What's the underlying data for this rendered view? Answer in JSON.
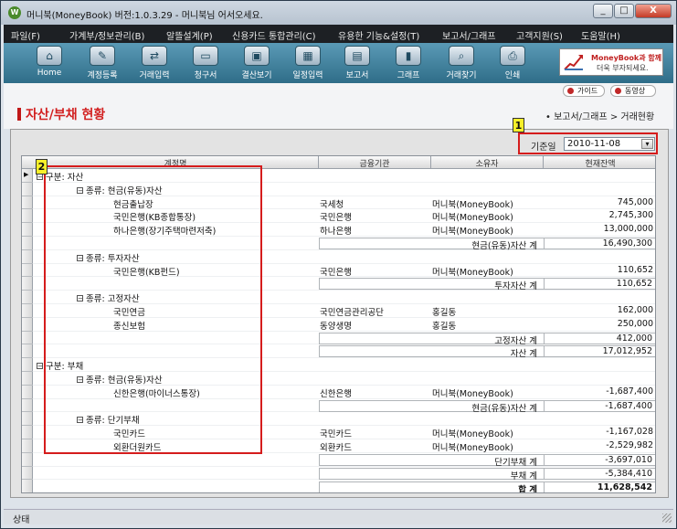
{
  "window": {
    "title": "머니북(MoneyBook) 버전:1.0.3.29 - 머니북님 어서오세요.",
    "app_icon_glyph": "W",
    "buttons": {
      "minimize": "_",
      "maximize": "□",
      "close": "X"
    }
  },
  "menu": [
    "파일(F)",
    "가계부/정보관리(B)",
    "알뜰설계(P)",
    "신용카드 통합관리(C)",
    "유용한 기능&설정(T)",
    "보고서/그래프",
    "고객지원(S)",
    "도움말(H)"
  ],
  "toolbar": [
    {
      "label": "Home",
      "icon": "home-icon",
      "glyph": "⌂"
    },
    {
      "label": "계정등록",
      "icon": "account-register-icon",
      "glyph": "✎"
    },
    {
      "label": "거래입력",
      "icon": "transaction-input-icon",
      "glyph": "⇄"
    },
    {
      "label": "청구서",
      "icon": "card-bill-icon",
      "glyph": "▭"
    },
    {
      "label": "결산보기",
      "icon": "monitor-icon",
      "glyph": "▣"
    },
    {
      "label": "일정입력",
      "icon": "calendar-icon",
      "glyph": "▦"
    },
    {
      "label": "보고서",
      "icon": "report-icon",
      "glyph": "▤"
    },
    {
      "label": "그래프",
      "icon": "bar-graph-icon",
      "glyph": "▮"
    },
    {
      "label": "거래찾기",
      "icon": "magnifier-icon",
      "glyph": "⌕"
    },
    {
      "label": "인쇄",
      "icon": "printer-icon",
      "glyph": "⎙"
    }
  ],
  "banner": {
    "line1": "MoneyBook과 함께",
    "line2": "더욱 부자되세요."
  },
  "help_links": {
    "guide": "가이드",
    "video": "동영상"
  },
  "page": {
    "title": "자산/부채 현황",
    "breadcrumb": "• 보고서/그래프 > 거래현황"
  },
  "date_filter": {
    "label": "기준일",
    "value": "2010-11-08"
  },
  "callouts": {
    "one": "1",
    "two": "2"
  },
  "grid": {
    "columns": [
      "계정명",
      "금융기관",
      "소유자",
      "현재잔액"
    ],
    "rows": [
      {
        "kind": "group",
        "level": 0,
        "text": "구분: 자산"
      },
      {
        "kind": "group",
        "level": 1,
        "text": "종류: 현금(유동)자산"
      },
      {
        "kind": "data",
        "name": "현금출납장",
        "bank": "국세청",
        "owner": "머니북(MoneyBook)",
        "amount": "745,000"
      },
      {
        "kind": "data",
        "name": "국민은행(KB종합통장)",
        "bank": "국민은행",
        "owner": "머니북(MoneyBook)",
        "amount": "2,745,300"
      },
      {
        "kind": "data",
        "name": "하나은행(장기주택마련저축)",
        "bank": "하나은행",
        "owner": "머니북(MoneyBook)",
        "amount": "13,000,000"
      },
      {
        "kind": "subtotal",
        "label": "현금(유동)자산 계",
        "amount": "16,490,300"
      },
      {
        "kind": "group",
        "level": 1,
        "text": "종류: 투자자산"
      },
      {
        "kind": "data",
        "name": "국민은행(KB펀드)",
        "bank": "국민은행",
        "owner": "머니북(MoneyBook)",
        "amount": "110,652"
      },
      {
        "kind": "subtotal",
        "label": "투자자산 계",
        "amount": "110,652"
      },
      {
        "kind": "group",
        "level": 1,
        "text": "종류: 고정자산"
      },
      {
        "kind": "data",
        "name": "국민연금",
        "bank": "국민연금관리공단",
        "owner": "홍길동",
        "amount": "162,000"
      },
      {
        "kind": "data",
        "name": "종신보험",
        "bank": "동양생명",
        "owner": "홍길동",
        "amount": "250,000"
      },
      {
        "kind": "subtotal",
        "label": "고정자산 계",
        "amount": "412,000"
      },
      {
        "kind": "subtotal",
        "label": "자산 계",
        "amount": "17,012,952"
      },
      {
        "kind": "group",
        "level": 0,
        "text": "구분: 부채"
      },
      {
        "kind": "group",
        "level": 1,
        "text": "종류: 현금(유동)자산"
      },
      {
        "kind": "data",
        "name": "신한은행(마이너스통장)",
        "bank": "신한은행",
        "owner": "머니북(MoneyBook)",
        "amount": "-1,687,400"
      },
      {
        "kind": "subtotal",
        "label": "현금(유동)자산 계",
        "amount": "-1,687,400"
      },
      {
        "kind": "group",
        "level": 1,
        "text": "종류: 단기부채"
      },
      {
        "kind": "data",
        "name": "국민카드",
        "bank": "국민카드",
        "owner": "머니북(MoneyBook)",
        "amount": "-1,167,028"
      },
      {
        "kind": "data",
        "name": "외환더원카드",
        "bank": "외환카드",
        "owner": "머니북(MoneyBook)",
        "amount": "-2,529,982"
      },
      {
        "kind": "subtotal",
        "label": "단기부채 계",
        "amount": "-3,697,010"
      },
      {
        "kind": "subtotal",
        "label": "부채 계",
        "amount": "-5,384,410"
      },
      {
        "kind": "total",
        "label": "합 계",
        "amount": "11,628,542"
      }
    ]
  },
  "status": "상태",
  "colors": {
    "accent_red": "#d51c1c",
    "toolbar_blue": "#3f7f9c",
    "callout_yellow": "#f8f02a"
  }
}
